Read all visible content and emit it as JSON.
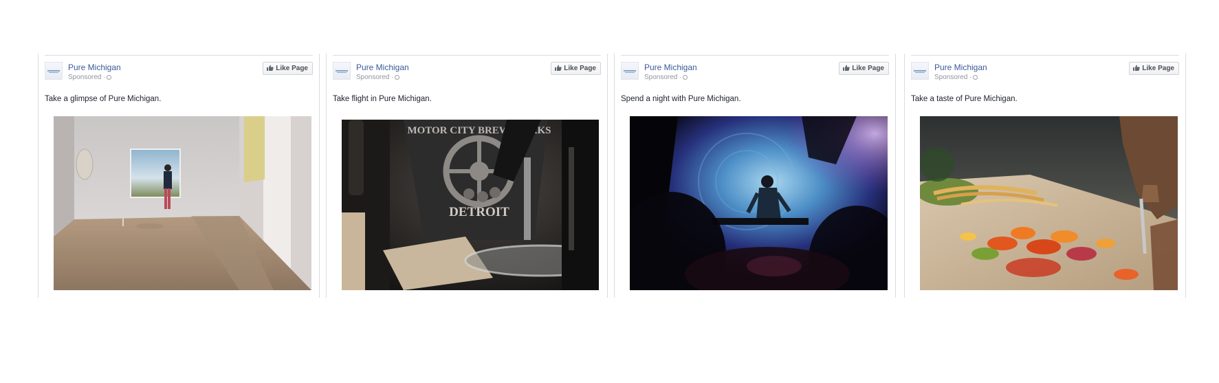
{
  "cards": [
    {
      "page_name": "Pure Michigan",
      "sponsored": "Sponsored ·",
      "like_label": "Like Page",
      "caption": "Take a glimpse of Pure Michigan.",
      "photo": "art-gallery-photo"
    },
    {
      "page_name": "Pure Michigan",
      "sponsored": "Sponsored ·",
      "like_label": "Like Page",
      "caption": "Take flight in Pure Michigan.",
      "photo": "brewery-photo",
      "shirt_text_top": "MOTOR CITY BREW WORKS",
      "shirt_text_bottom": "DETROIT"
    },
    {
      "page_name": "Pure Michigan",
      "sponsored": "Sponsored ·",
      "like_label": "Like Page",
      "caption": "Spend a night with Pure Michigan.",
      "photo": "dj-concert-photo"
    },
    {
      "page_name": "Pure Michigan",
      "sponsored": "Sponsored ·",
      "like_label": "Like Page",
      "caption": "Take a taste of Pure Michigan.",
      "photo": "chopping-vegetables-photo"
    }
  ],
  "colors": {
    "link": "#3b5998",
    "meta": "#90949c",
    "border": "#d9dbe0"
  }
}
